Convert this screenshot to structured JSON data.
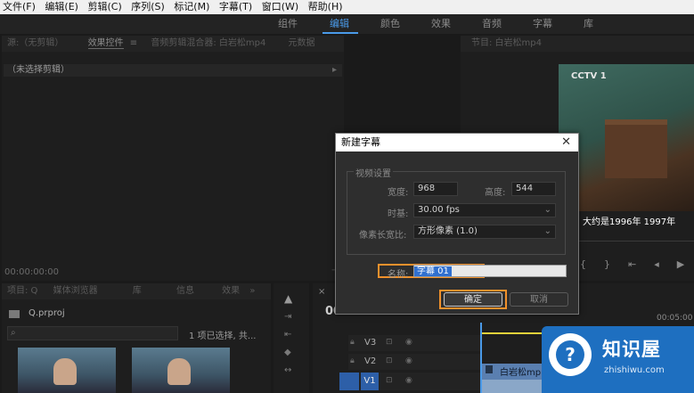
{
  "menu": [
    "文件(F)",
    "编辑(E)",
    "剪辑(C)",
    "序列(S)",
    "标记(M)",
    "字幕(T)",
    "窗口(W)",
    "帮助(H)"
  ],
  "workspaces": [
    "组件",
    "编辑",
    "颜色",
    "效果",
    "音频",
    "字幕",
    "库"
  ],
  "active_workspace": "编辑",
  "source_panel": {
    "tabs": [
      "源:（无剪辑）",
      "效果控件",
      "≡",
      "音频剪辑混合器: 白岩松mp4",
      "元数据"
    ],
    "no_clip": "（未选择剪辑）",
    "timecode": "00:00:00:00"
  },
  "program_panel": {
    "title": "节目: 白岩松mp4",
    "channel_logo": "CCTV 1",
    "subtitle": "大约是1996年 1997年"
  },
  "project_panel": {
    "tabs": [
      "项目: Q",
      "媒体浏览器",
      "库",
      "信息",
      "效果"
    ],
    "file": "Q.prproj",
    "selection_status": "1 项已选择, 共..."
  },
  "timeline": {
    "timecode": "00",
    "ruler_time": "00:05:00",
    "tracks": [
      "V3",
      "V2",
      "V1"
    ],
    "clip_label": "白岩松mp"
  },
  "dialog": {
    "title": "新建字幕",
    "group_label": "视频设置",
    "width_label": "宽度:",
    "width_value": "968",
    "height_label": "高度:",
    "height_value": "544",
    "timebase_label": "时基:",
    "timebase_value": "30.00 fps",
    "pixel_aspect_label": "像素长宽比:",
    "pixel_aspect_value": "方形像素 (1.0)",
    "name_label": "名称:",
    "name_value": "字幕 01",
    "ok_label": "确定",
    "cancel_label": "取消"
  },
  "watermark": {
    "title": "知识屋",
    "url": "zhishiwu.com"
  },
  "colors": {
    "accent": "#4a9ae8",
    "highlight": "#f0912c",
    "watermark": "#1e6fc0"
  }
}
